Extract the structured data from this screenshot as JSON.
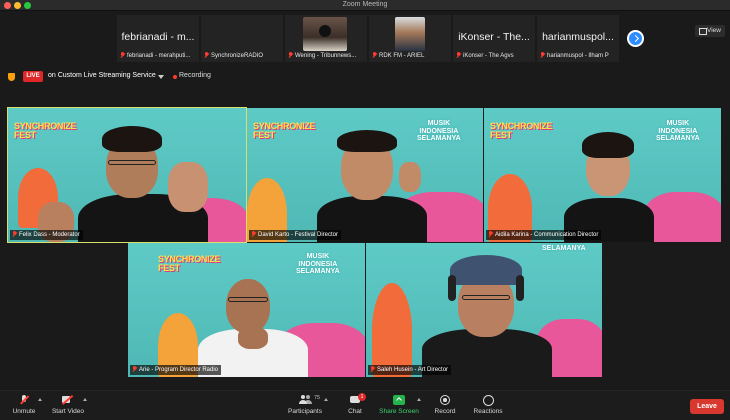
{
  "window": {
    "title": "Zoom Meeting"
  },
  "strip": {
    "thumbnails": [
      {
        "big_name": "febrianadi - m...",
        "label": "febrianadi - merahputi..."
      },
      {
        "big_name": "",
        "label": "SynchronizeRADIO"
      },
      {
        "big_name": "",
        "label": "Wening - Tribunnews..."
      },
      {
        "big_name": "",
        "label": "RDK FM - ARIEL"
      },
      {
        "big_name": "iKonser - The...",
        "label": "iKonser - The Agvs"
      },
      {
        "big_name": "harianmuspol...",
        "label": "harianmuspol - Ilham P"
      }
    ],
    "view_label": "View"
  },
  "live": {
    "badge": "LIVE",
    "service": "on Custom Live Streaming Service",
    "recording": "Recording"
  },
  "tiles": {
    "logo_line1": "SYNCHRONIZE",
    "logo_line2": "FEST",
    "musik_line1": "MUSIK",
    "musik_line2": "INDONESIA",
    "musik_line3": "SELAMANYA",
    "participants": [
      {
        "label": "Felix Dass - Moderator"
      },
      {
        "label": "David Karto - Festival Director"
      },
      {
        "label": "Aidila Karina - Communication Director"
      },
      {
        "label": "Arie - Program Director Radio"
      },
      {
        "label": "Saleh Husein - Art Director"
      }
    ]
  },
  "toolbar": {
    "unmute": "Unmute",
    "start_video": "Start Video",
    "participants": "Participants",
    "participants_count": "75",
    "chat": "Chat",
    "chat_badge": "1",
    "share_screen": "Share Screen",
    "record": "Record",
    "reactions": "Reactions",
    "leave": "Leave"
  },
  "colors": {
    "accent": "#2d8cff",
    "live_red": "#e02828",
    "share_green": "#24b24b",
    "active_speaker": "#d6e06a",
    "tile_bg": "#56c3c0"
  }
}
